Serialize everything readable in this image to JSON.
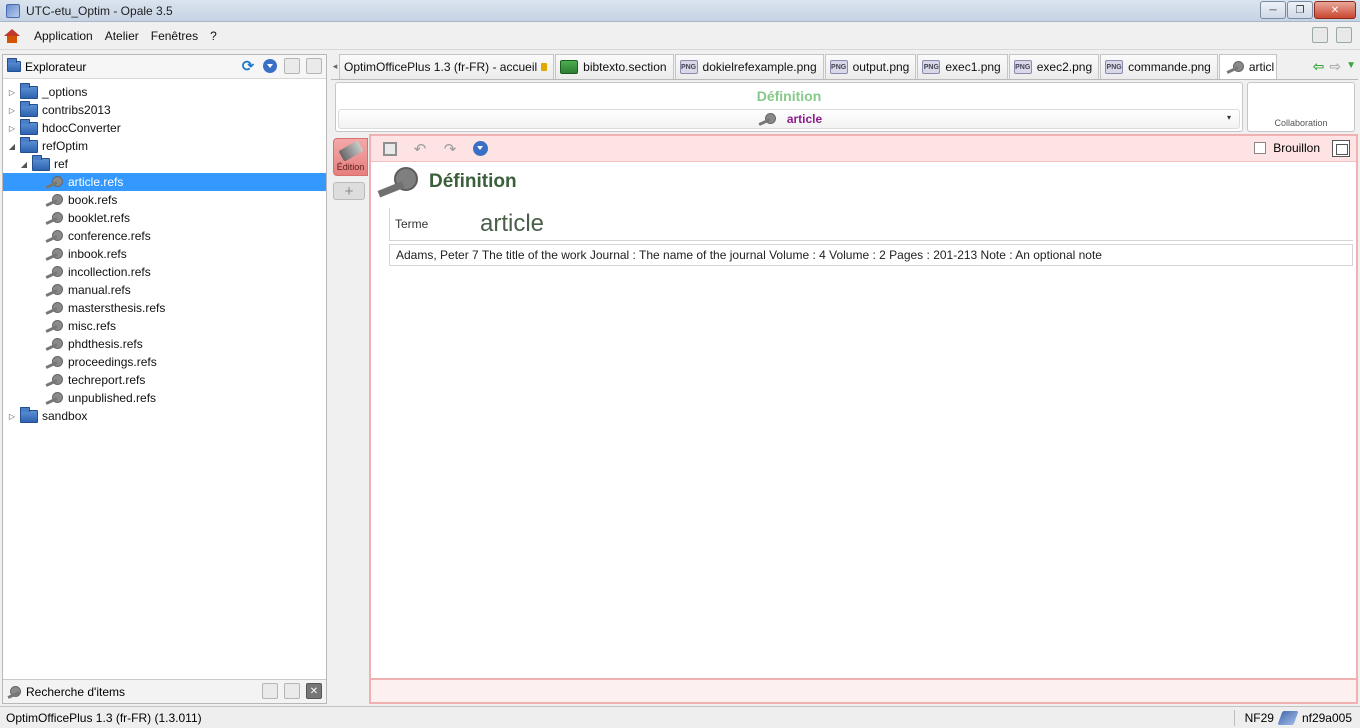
{
  "window": {
    "title": "UTC-etu_Optim - Opale 3.5",
    "minimize": "─",
    "maximize": "❐",
    "close": "✕"
  },
  "menu": {
    "items": [
      "Application",
      "Atelier",
      "Fenêtres",
      "?"
    ]
  },
  "explorer": {
    "title": "Explorateur",
    "refresh": "⟳",
    "tree": [
      {
        "label": "_options",
        "type": "folder",
        "twisty": "▷"
      },
      {
        "label": "contribs2013",
        "type": "folder",
        "twisty": "▷"
      },
      {
        "label": "hdocConverter",
        "type": "folder",
        "twisty": "▷"
      },
      {
        "label": "refOptim",
        "type": "folder",
        "twisty": "◢"
      },
      {
        "label": "ref",
        "type": "folder",
        "twisty": "◢"
      },
      {
        "label": "article.refs",
        "type": "ref",
        "selected": true
      },
      {
        "label": "book.refs",
        "type": "ref"
      },
      {
        "label": "booklet.refs",
        "type": "ref"
      },
      {
        "label": "conference.refs",
        "type": "ref"
      },
      {
        "label": "inbook.refs",
        "type": "ref"
      },
      {
        "label": "incollection.refs",
        "type": "ref"
      },
      {
        "label": "manual.refs",
        "type": "ref"
      },
      {
        "label": "mastersthesis.refs",
        "type": "ref"
      },
      {
        "label": "misc.refs",
        "type": "ref"
      },
      {
        "label": "phdthesis.refs",
        "type": "ref"
      },
      {
        "label": "proceedings.refs",
        "type": "ref"
      },
      {
        "label": "techreport.refs",
        "type": "ref"
      },
      {
        "label": "unpublished.refs",
        "type": "ref"
      },
      {
        "label": "sandbox",
        "type": "folder",
        "twisty": "▷"
      }
    ]
  },
  "search_panel": {
    "title": "Recherche d'items",
    "close": "✕"
  },
  "tabs": [
    {
      "label": "OptimOfficePlus 1.3 (fr-FR) - accueil",
      "icon": "home"
    },
    {
      "label": "bibtexto.section",
      "icon": "section"
    },
    {
      "label": "dokielrefexample.png",
      "icon": "png"
    },
    {
      "label": "output.png",
      "icon": "png"
    },
    {
      "label": "exec1.png",
      "icon": "png"
    },
    {
      "label": "exec2.png",
      "icon": "png"
    },
    {
      "label": "commande.png",
      "icon": "png"
    },
    {
      "label": "articl",
      "icon": "key",
      "active": true
    }
  ],
  "tab_scroll": "◂",
  "tab_nav": {
    "back": "⇦",
    "forward": "⇨",
    "list": "▼"
  },
  "icon_labels": {
    "png": "PNG"
  },
  "header": {
    "title": "Définition",
    "selected": "article",
    "caret": "▾",
    "collaboration": "Collaboration"
  },
  "editor": {
    "side_tab_label": "Édition",
    "side_add": "+",
    "undo": "↶",
    "redo": "↷",
    "draft_label": "Brouillon",
    "heading": "Définition",
    "term_label": "Terme",
    "term_value": "article",
    "content": "Adams, Peter 7 The title of the work Journal : The name of the journal Volume : 4 Volume : 2 Pages : 201-213 Note : An optional note"
  },
  "status": {
    "left": "OptimOfficePlus 1.3 (fr-FR) (1.3.011)",
    "nf": "NF29",
    "id": "nf29a005"
  },
  "colors": {
    "selection": "#3399ff",
    "definition_title": "#86c98a",
    "selected_value": "#8e1b8e",
    "editor_border": "#f1b1b1"
  }
}
